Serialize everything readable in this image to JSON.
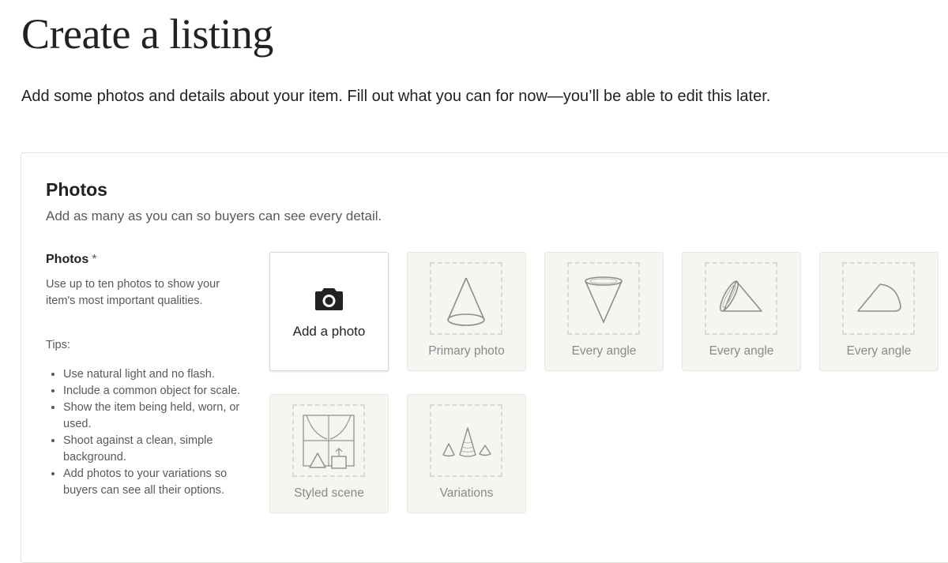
{
  "header": {
    "title": "Create a listing",
    "subtitle": "Add some photos and details about your item. Fill out what you can for now—you’ll be able to edit this later."
  },
  "photos_section": {
    "title": "Photos",
    "description": "Add as many as you can so buyers can see every detail.",
    "field_label": "Photos",
    "required_mark": "*",
    "help_text": "Use up to ten photos to show your item's most important qualities.",
    "tips_title": "Tips:",
    "tips": [
      "Use natural light and no flash.",
      "Include a common object for scale.",
      "Show the item being held, worn, or used.",
      "Shoot against a clean, simple background.",
      "Add photos to your variations so buyers can see all their options."
    ],
    "add_photo_label": "Add a photo",
    "add_photo_icon": "camera-icon",
    "slots": [
      {
        "label": "Primary photo",
        "icon": "cone-upright-icon"
      },
      {
        "label": "Every angle",
        "icon": "cone-inverted-icon"
      },
      {
        "label": "Every angle",
        "icon": "cone-tilted-icon"
      },
      {
        "label": "Every angle",
        "icon": "cone-side-icon"
      },
      {
        "label": "Styled scene",
        "icon": "window-scene-icon"
      },
      {
        "label": "Variations",
        "icon": "three-cones-icon"
      }
    ]
  },
  "colors": {
    "text": "#222222",
    "muted": "#595959",
    "placeholder_bg": "#f5f5f1",
    "illustration_stroke": "#8f8f8a"
  }
}
